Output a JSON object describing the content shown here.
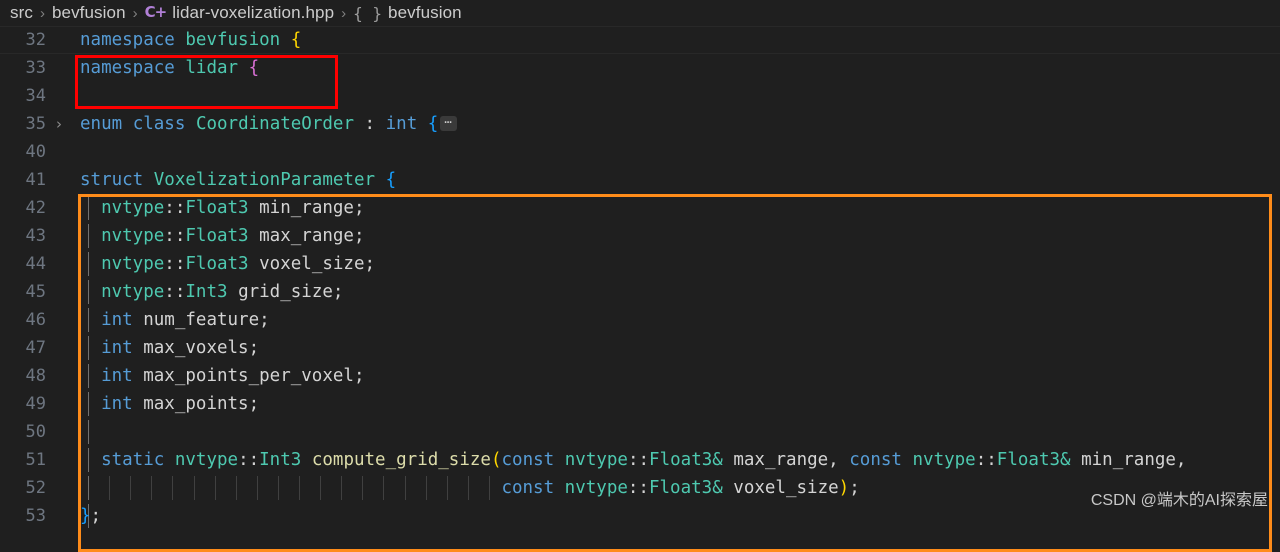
{
  "breadcrumb": {
    "items": [
      {
        "label": "src",
        "icon": null
      },
      {
        "label": "bevfusion",
        "icon": null
      },
      {
        "label": "lidar-voxelization.hpp",
        "icon": "cpp-file-icon",
        "icon_glyph": "C+"
      },
      {
        "label": "bevfusion",
        "icon": "namespace-symbol-icon",
        "icon_glyph": "{ }"
      }
    ],
    "separator": "›"
  },
  "editor": {
    "fold_chevron": "›",
    "fold_badge": "⋯",
    "lines": [
      {
        "num": "32",
        "text": "namespace bevfusion {"
      },
      {
        "num": "33",
        "text": "namespace lidar {"
      },
      {
        "num": "34",
        "text": ""
      },
      {
        "num": "35",
        "text": "enum class CoordinateOrder : int {⋯"
      },
      {
        "num": "40",
        "text": ""
      },
      {
        "num": "41",
        "text": "struct VoxelizationParameter {"
      },
      {
        "num": "42",
        "text": "  nvtype::Float3 min_range;"
      },
      {
        "num": "43",
        "text": "  nvtype::Float3 max_range;"
      },
      {
        "num": "44",
        "text": "  nvtype::Float3 voxel_size;"
      },
      {
        "num": "45",
        "text": "  nvtype::Int3 grid_size;"
      },
      {
        "num": "46",
        "text": "  int num_feature;"
      },
      {
        "num": "47",
        "text": "  int max_voxels;"
      },
      {
        "num": "48",
        "text": "  int max_points_per_voxel;"
      },
      {
        "num": "49",
        "text": "  int max_points;"
      },
      {
        "num": "50",
        "text": ""
      },
      {
        "num": "51",
        "text": "  static nvtype::Int3 compute_grid_size(const nvtype::Float3& max_range, const nvtype::Float3& min_range,"
      },
      {
        "num": "52",
        "text": "                                        const nvtype::Float3& voxel_size);"
      },
      {
        "num": "53",
        "text": "};"
      }
    ]
  },
  "annotations": {
    "red_box": {
      "label": "namespace-highlight-box",
      "color": "#ff0000"
    },
    "orange_box": {
      "label": "struct-highlight-box",
      "color": "#ff8c1a"
    }
  },
  "watermark": {
    "text": "CSDN @端木的AI探索屋"
  },
  "colors": {
    "background": "#1f1f1f",
    "keyword": "#569cd6",
    "type": "#4ec9b0",
    "function": "#dcdcaa",
    "identifier": "#d4d4d4",
    "bracket1": "#ffd700",
    "bracket2": "#da70d6",
    "bracket3": "#179fff",
    "line_number": "#6e7681"
  }
}
